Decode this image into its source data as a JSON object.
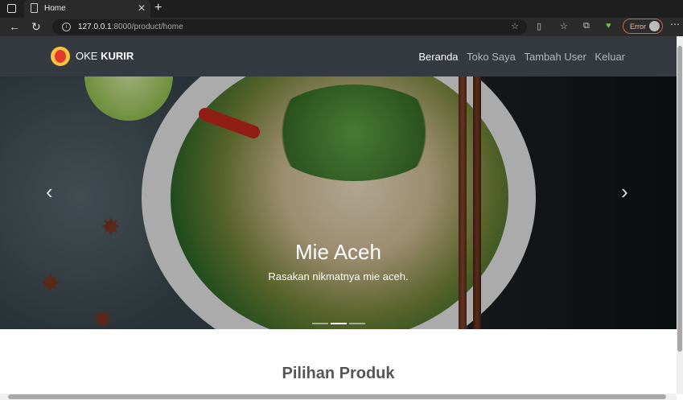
{
  "browser": {
    "tab_title": "Home",
    "new_tab": "+",
    "close": "✕",
    "url_host": "127.0.0.1",
    "url_rest": ":8000/product/home",
    "error_label": "Error"
  },
  "navbar": {
    "brand_prefix": "OKE",
    "brand_bold": "KURIR",
    "links": [
      {
        "label": "Beranda",
        "active": true
      },
      {
        "label": "Toko Saya",
        "active": false
      },
      {
        "label": "Tambah User",
        "active": false
      },
      {
        "label": "Keluar",
        "active": false
      }
    ]
  },
  "carousel": {
    "title": "Mie Aceh",
    "caption": "Rasakan nikmatnya mie aceh.",
    "prev": "‹",
    "next": "›",
    "active_index": 1,
    "indicator_count": 3
  },
  "section": {
    "title": "Pilihan Produk"
  }
}
